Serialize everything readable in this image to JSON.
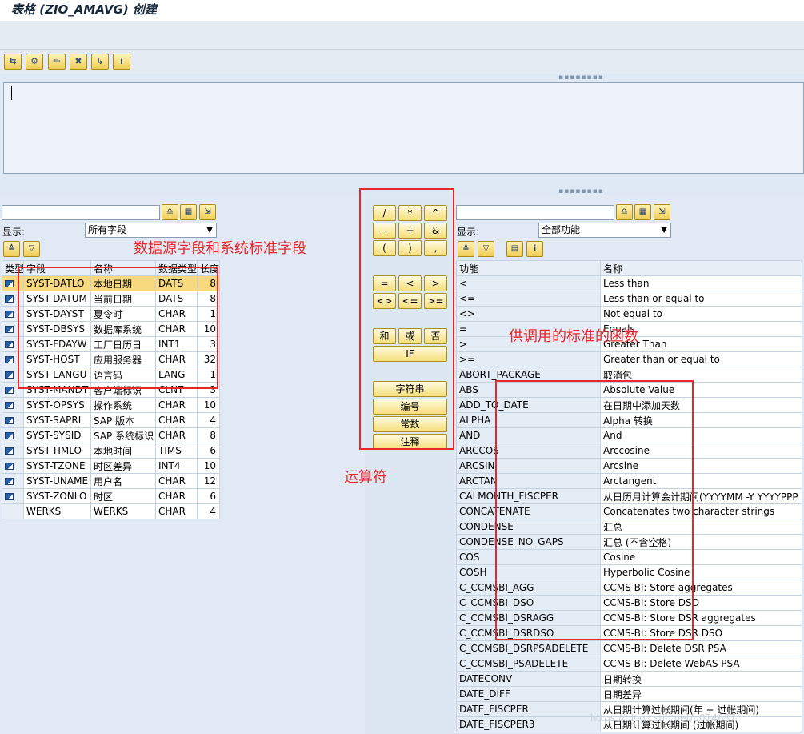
{
  "window": {
    "title": "表格 (ZIO_AMAVG) 创建"
  },
  "toolbar": {
    "icons": [
      "switch-icon",
      "tools-icon",
      "pencil-icon",
      "trash-icon",
      "check-icon",
      "info-icon"
    ],
    "glyphs": [
      "⇆",
      "✎",
      "✏",
      "🗑",
      "↳",
      "i"
    ]
  },
  "left": {
    "show_label": "显示:",
    "filter_value": "所有字段",
    "headers": [
      "类型",
      "字段",
      "名称",
      "数据类型",
      "长度"
    ],
    "rows": [
      {
        "field": "SYST-DATLO",
        "name": "本地日期",
        "type": "DATS",
        "len": "8"
      },
      {
        "field": "SYST-DATUM",
        "name": "当前日期",
        "type": "DATS",
        "len": "8"
      },
      {
        "field": "SYST-DAYST",
        "name": "夏令时",
        "type": "CHAR",
        "len": "1"
      },
      {
        "field": "SYST-DBSYS",
        "name": "数据库系统",
        "type": "CHAR",
        "len": "10"
      },
      {
        "field": "SYST-FDAYW",
        "name": "工厂日历日",
        "type": "INT1",
        "len": "3"
      },
      {
        "field": "SYST-HOST",
        "name": "应用服务器",
        "type": "CHAR",
        "len": "32"
      },
      {
        "field": "SYST-LANGU",
        "name": "语言码",
        "type": "LANG",
        "len": "1"
      },
      {
        "field": "SYST-MANDT",
        "name": "客户端标识",
        "type": "CLNT",
        "len": "3"
      },
      {
        "field": "SYST-OPSYS",
        "name": "操作系统",
        "type": "CHAR",
        "len": "10"
      },
      {
        "field": "SYST-SAPRL",
        "name": "SAP 版本",
        "type": "CHAR",
        "len": "4"
      },
      {
        "field": "SYST-SYSID",
        "name": "SAP 系统标识",
        "type": "CHAR",
        "len": "8"
      },
      {
        "field": "SYST-TIMLO",
        "name": "本地时间",
        "type": "TIMS",
        "len": "6"
      },
      {
        "field": "SYST-TZONE",
        "name": "时区差异",
        "type": "INT4",
        "len": "10"
      },
      {
        "field": "SYST-UNAME",
        "name": "用户名",
        "type": "CHAR",
        "len": "12"
      },
      {
        "field": "SYST-ZONLO",
        "name": "时区",
        "type": "CHAR",
        "len": "6"
      },
      {
        "field": "WERKS",
        "name": "WERKS",
        "type": "CHAR",
        "len": "4"
      }
    ]
  },
  "operators": {
    "row1": [
      "/",
      "*",
      "^"
    ],
    "row2": [
      "-",
      "+",
      "&"
    ],
    "row3": [
      "(",
      ")",
      ","
    ],
    "row4": [
      "=",
      "<",
      ">"
    ],
    "row5": [
      "<>",
      "<=",
      ">="
    ],
    "row6": [
      "和",
      "或",
      "否"
    ],
    "if": "IF",
    "buttons": [
      "字符串",
      "编号",
      "常数",
      "注释"
    ]
  },
  "right": {
    "show_label": "显示:",
    "filter_value": "全部功能",
    "headers": [
      "功能",
      "名称"
    ],
    "rows": [
      {
        "fn": "<",
        "name": "Less than"
      },
      {
        "fn": "<=",
        "name": "Less than or equal to"
      },
      {
        "fn": "<>",
        "name": "Not equal to"
      },
      {
        "fn": "=",
        "name": "Equals"
      },
      {
        "fn": ">",
        "name": "Greater Than"
      },
      {
        "fn": ">=",
        "name": "Greater than or equal to"
      },
      {
        "fn": "ABORT_PACKAGE",
        "name": "取消包"
      },
      {
        "fn": "ABS",
        "name": "Absolute Value"
      },
      {
        "fn": "ADD_TO_DATE",
        "name": "在日期中添加天数"
      },
      {
        "fn": "ALPHA",
        "name": "Alpha 转换"
      },
      {
        "fn": "AND",
        "name": "And"
      },
      {
        "fn": "ARCCOS",
        "name": "Arccosine"
      },
      {
        "fn": "ARCSIN",
        "name": "Arcsine"
      },
      {
        "fn": "ARCTAN",
        "name": "Arctangent"
      },
      {
        "fn": "CALMONTH_FISCPER",
        "name": "从日历月计算会计期间(YYYYMM -Y YYYYPPP"
      },
      {
        "fn": "CONCATENATE",
        "name": "Concatenates two character strings"
      },
      {
        "fn": "CONDENSE",
        "name": "汇总"
      },
      {
        "fn": "CONDENSE_NO_GAPS",
        "name": "汇总 (不含空格)"
      },
      {
        "fn": "COS",
        "name": "Cosine"
      },
      {
        "fn": "COSH",
        "name": "Hyperbolic Cosine"
      },
      {
        "fn": "C_CCMSBI_AGG",
        "name": "CCMS-BI: Store aggregates"
      },
      {
        "fn": "C_CCMSBI_DSO",
        "name": "CCMS-BI: Store DSO"
      },
      {
        "fn": "C_CCMSBI_DSRAGG",
        "name": "CCMS-BI: Store DSR aggregates"
      },
      {
        "fn": "C_CCMSBI_DSRDSO",
        "name": "CCMS-BI: Store DSR DSO"
      },
      {
        "fn": "C_CCMSBI_DSRPSADELETE",
        "name": "CCMS-BI: Delete DSR PSA"
      },
      {
        "fn": "C_CCMSBI_PSADELETE",
        "name": "CCMS-BI: Delete WebAS PSA"
      },
      {
        "fn": "DATECONV",
        "name": "日期转换"
      },
      {
        "fn": "DATE_DIFF",
        "name": "日期差异"
      },
      {
        "fn": "DATE_FISCPER",
        "name": "从日期计算过帐期间(年 + 过帐期间)"
      },
      {
        "fn": "DATE_FISCPER3",
        "name": "从日期计算过帐期间 (过帐期间)"
      }
    ]
  },
  "annotations": {
    "fields": "数据源字段和系统标准字段",
    "operators": "运算符",
    "functions": "供调用的标准的函数",
    "accent": "#e8262b"
  },
  "watermark": "https://blog.csdn.net/u014637"
}
